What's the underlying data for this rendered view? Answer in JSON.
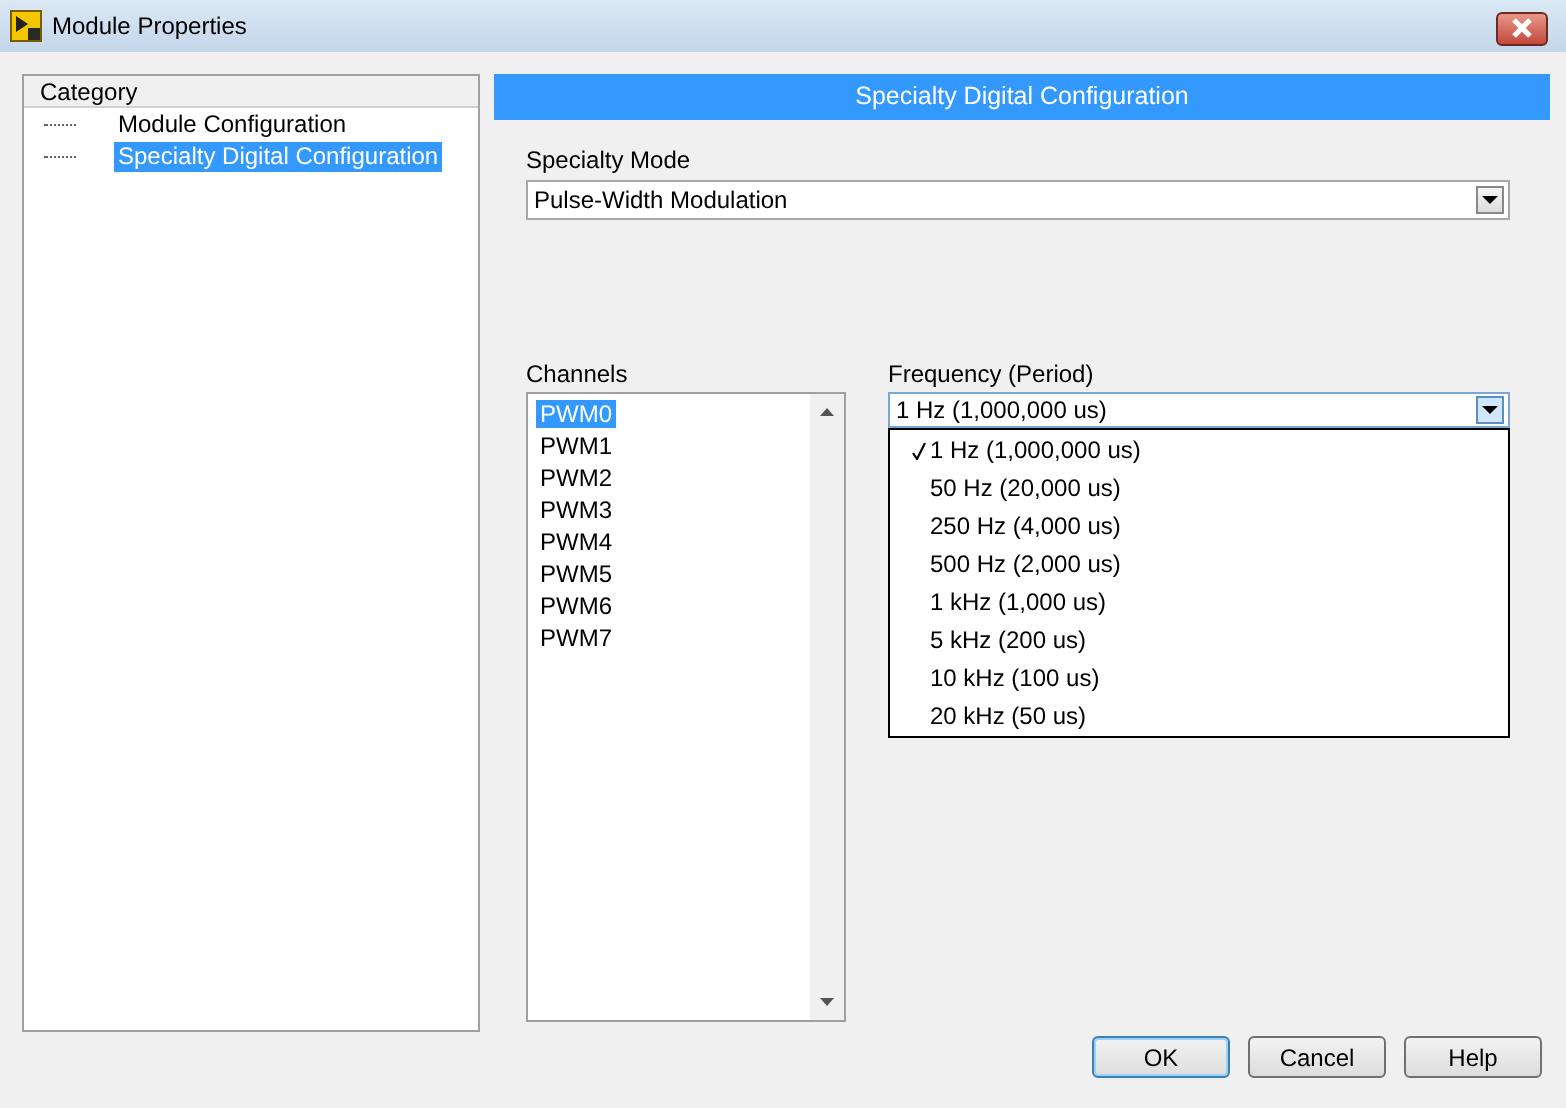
{
  "window": {
    "title": "Module Properties"
  },
  "category": {
    "heading": "Category",
    "items": [
      {
        "label": "Module Configuration",
        "selected": false
      },
      {
        "label": "Specialty Digital Configuration",
        "selected": true
      }
    ]
  },
  "panel": {
    "title": "Specialty Digital Configuration",
    "specialty_mode": {
      "label": "Specialty Mode",
      "value": "Pulse-Width Modulation"
    },
    "channels": {
      "label": "Channels",
      "items": [
        {
          "label": "PWM0",
          "selected": true
        },
        {
          "label": "PWM1",
          "selected": false
        },
        {
          "label": "PWM2",
          "selected": false
        },
        {
          "label": "PWM3",
          "selected": false
        },
        {
          "label": "PWM4",
          "selected": false
        },
        {
          "label": "PWM5",
          "selected": false
        },
        {
          "label": "PWM6",
          "selected": false
        },
        {
          "label": "PWM7",
          "selected": false
        }
      ]
    },
    "frequency": {
      "label": "Frequency (Period)",
      "value": "1 Hz (1,000,000 us)",
      "expanded": true,
      "options": [
        {
          "label": "1 Hz (1,000,000 us)",
          "selected": true
        },
        {
          "label": "50 Hz (20,000 us)",
          "selected": false
        },
        {
          "label": "250 Hz (4,000 us)",
          "selected": false
        },
        {
          "label": "500 Hz (2,000 us)",
          "selected": false
        },
        {
          "label": "1 kHz (1,000 us)",
          "selected": false
        },
        {
          "label": "5 kHz (200 us)",
          "selected": false
        },
        {
          "label": "10 kHz (100 us)",
          "selected": false
        },
        {
          "label": "20 kHz (50 us)",
          "selected": false
        }
      ]
    }
  },
  "buttons": [
    {
      "label": "OK",
      "default": true
    },
    {
      "label": "Cancel",
      "default": false
    },
    {
      "label": "Help",
      "default": false
    }
  ]
}
